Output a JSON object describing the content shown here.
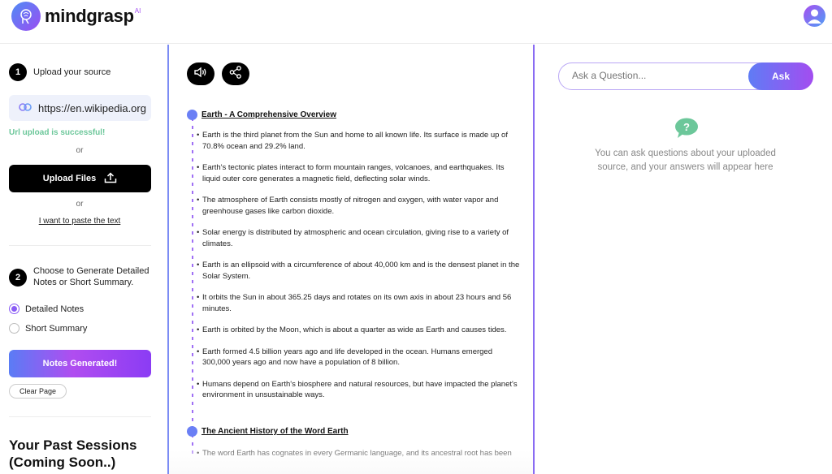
{
  "header": {
    "brand": "mindgrasp",
    "brand_suffix": "AI"
  },
  "left": {
    "step1": {
      "number": "1",
      "label": "Upload your source"
    },
    "url_value": "https://en.wikipedia.org",
    "url_status": "Url upload is successful!",
    "or_1": "or",
    "upload_files": "Upload Files",
    "or_2": "or",
    "paste_link": "I want to paste the text",
    "step2": {
      "number": "2",
      "label": "Choose to Generate Detailed Notes or Short Summary."
    },
    "options": [
      {
        "label": "Detailed Notes",
        "selected": true
      },
      {
        "label": "Short Summary",
        "selected": false
      }
    ],
    "generate_button": "Notes Generated!",
    "clear_button": "Clear Page",
    "past_sessions": "Your Past Sessions (Coming Soon..)"
  },
  "notes": {
    "sections": [
      {
        "title": "Earth - A Comprehensive Overview",
        "bullets": [
          "Earth is the third planet from the Sun and home to all known life. Its surface is made up of 70.8% ocean and 29.2% land.",
          "Earth's tectonic plates interact to form mountain ranges, volcanoes, and earthquakes. Its liquid outer core generates a magnetic field, deflecting solar winds.",
          "The atmosphere of Earth consists mostly of nitrogen and oxygen, with water vapor and greenhouse gases like carbon dioxide.",
          "Solar energy is distributed by atmospheric and ocean circulation, giving rise to a variety of climates.",
          "Earth is an ellipsoid with a circumference of about 40,000 km and is the densest planet in the Solar System.",
          "It orbits the Sun in about 365.25 days and rotates on its own axis in about 23 hours and 56 minutes.",
          "Earth is orbited by the Moon, which is about a quarter as wide as Earth and causes tides.",
          "Earth formed 4.5 billion years ago and life developed in the ocean. Humans emerged 300,000 years ago and now have a population of 8 billion.",
          "Humans depend on Earth's biosphere and natural resources, but have impacted the planet's environment in unsustainable ways."
        ]
      },
      {
        "title": "The Ancient History of the Word Earth",
        "bullets": [
          "The word Earth has cognates in every Germanic language, and its ancestral root has been"
        ]
      }
    ]
  },
  "qa": {
    "placeholder": "Ask a Question...",
    "ask_button": "Ask",
    "empty_message": "You can ask questions about your uploaded source, and your answers will appear here"
  },
  "colors": {
    "accent_purple": "#a34df0",
    "accent_blue": "#5f7cf5",
    "success_green": "#6cc79a",
    "qa_icon_green": "#6cc79a"
  }
}
